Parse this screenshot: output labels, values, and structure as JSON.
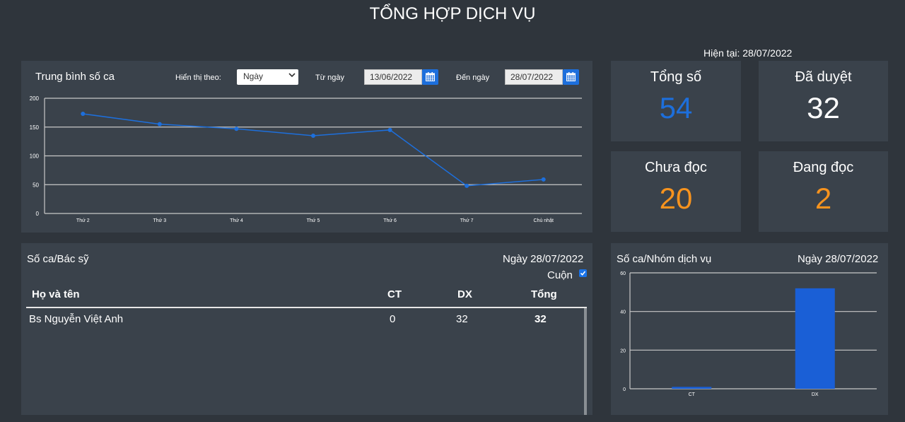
{
  "page": {
    "title": "TỔNG HỢP DỊCH VỤ",
    "current_date": "Hiện tại: 28/07/2022"
  },
  "line_panel": {
    "title": "Trung bình số ca",
    "display_label": "Hiển thị theo:",
    "display_value": "Ngày",
    "from_label": "Từ ngày",
    "from_value": "13/06/2022",
    "to_label": "Đến ngày",
    "to_value": "28/07/2022"
  },
  "tiles": [
    {
      "label": "Tổng số",
      "value": "54",
      "color": "#1d6fdc"
    },
    {
      "label": "Đã duyệt",
      "value": "32",
      "color": "#ffffff"
    },
    {
      "label": "Chưa đọc",
      "value": "20",
      "color": "#f7931e"
    },
    {
      "label": "Đang đọc",
      "value": "2",
      "color": "#f7931e"
    }
  ],
  "doctor_panel": {
    "title": "Số ca/Bác sỹ",
    "date": "Ngày 28/07/2022",
    "scroll_label": "Cuộn",
    "scroll_checked": true,
    "columns": [
      "Họ và tên",
      "CT",
      "DX",
      "Tổng"
    ],
    "rows": [
      {
        "name": "Bs Nguyễn Việt Anh",
        "ct": "0",
        "dx": "32",
        "total": "32"
      }
    ]
  },
  "group_panel": {
    "title": "Số ca/Nhóm dịch vụ",
    "date": "Ngày 28/07/2022"
  },
  "chart_data": [
    {
      "type": "line",
      "categories": [
        "Thứ 2",
        "Thứ 3",
        "Thứ 4",
        "Thứ 5",
        "Thứ 6",
        "Thứ 7",
        "Chủ nhật"
      ],
      "values": [
        173,
        155,
        147,
        135,
        145,
        48,
        59
      ],
      "ylim": [
        0,
        200
      ],
      "yticks": [
        0,
        50,
        100,
        150,
        200
      ],
      "grid": true,
      "color": "#1d6fdc"
    },
    {
      "type": "bar",
      "categories": [
        "CT",
        "DX"
      ],
      "values": [
        1,
        52
      ],
      "ylim": [
        0,
        60
      ],
      "yticks": [
        0,
        20,
        40,
        60
      ],
      "grid": true,
      "color": "#1a5fd6"
    }
  ]
}
